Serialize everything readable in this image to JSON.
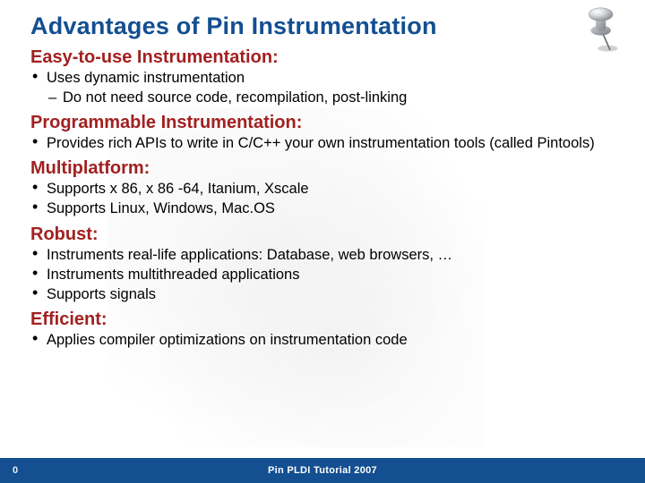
{
  "title": "Advantages of Pin Instrumentation",
  "sections": [
    {
      "heading": "Easy-to-use Instrumentation:",
      "bullets": [
        {
          "text": "Uses dynamic instrumentation",
          "sub": [
            "Do not need source code, recompilation, post-linking"
          ]
        }
      ]
    },
    {
      "heading": "Programmable Instrumentation:",
      "bullets": [
        {
          "text": "Provides rich APIs to write in C/C++ your own instrumentation tools (called Pintools)"
        }
      ]
    },
    {
      "heading": "Multiplatform:",
      "bullets": [
        {
          "text": "Supports x 86, x 86 -64, Itanium, Xscale"
        },
        {
          "text": "Supports Linux, Windows, Mac.OS"
        }
      ]
    },
    {
      "heading": "Robust:",
      "bullets": [
        {
          "text": "Instruments real-life applications: Database, web browsers, …"
        },
        {
          "text": "Instruments multithreaded applications"
        },
        {
          "text": "Supports signals"
        }
      ]
    },
    {
      "heading": "Efficient:",
      "bullets": [
        {
          "text": "Applies compiler optimizations on instrumentation code"
        }
      ]
    }
  ],
  "footer": {
    "page": "0",
    "text": "Pin PLDI Tutorial 2007"
  },
  "icons": {
    "pushpin": "pushpin-icon"
  },
  "colors": {
    "title": "#134f91",
    "heading": "#a22020",
    "footer_bg": "#134f91"
  }
}
